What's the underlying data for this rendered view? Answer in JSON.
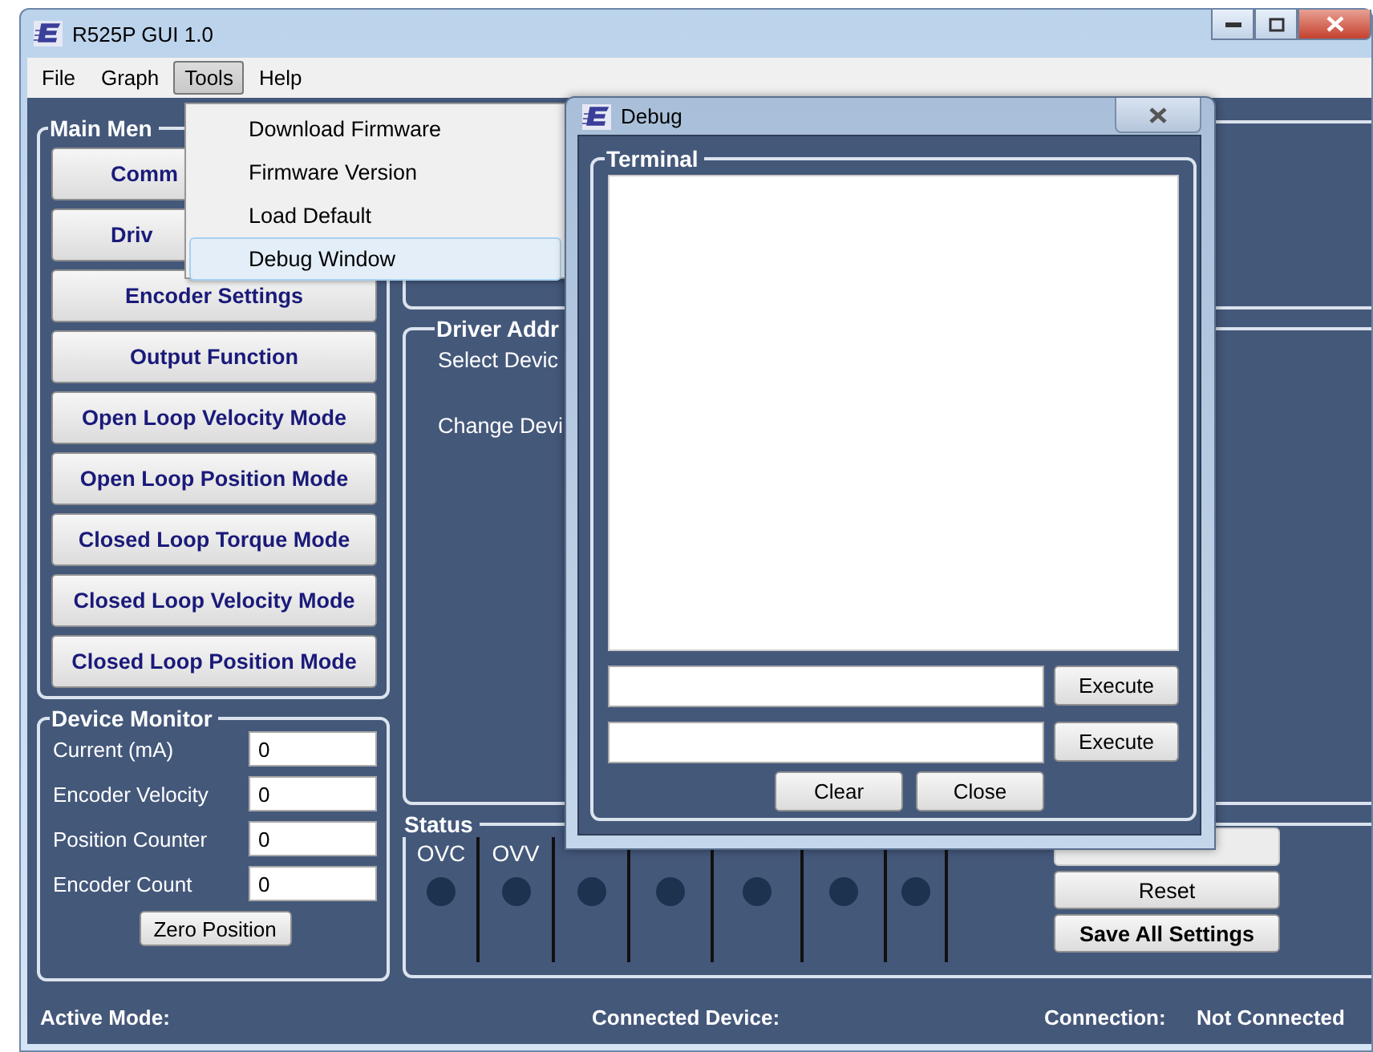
{
  "window": {
    "title": "R525P GUI 1.0"
  },
  "menu_bar": [
    {
      "label": "File",
      "selected": false
    },
    {
      "label": "Graph",
      "selected": false
    },
    {
      "label": "Tools",
      "selected": true
    },
    {
      "label": "Help",
      "selected": false
    }
  ],
  "tools_menu": [
    {
      "label": "Download Firmware",
      "selected": false
    },
    {
      "label": "Firmware Version",
      "selected": false
    },
    {
      "label": "Load Default",
      "selected": false
    },
    {
      "label": "Debug Window",
      "selected": true
    }
  ],
  "main_menu": {
    "title": "Main Men",
    "buttons": [
      {
        "kind": "covered",
        "label": "Comm"
      },
      {
        "kind": "covered",
        "label": "Driv"
      },
      {
        "kind": "normal",
        "label": "Encoder Settings"
      },
      {
        "kind": "normal",
        "label": "Output Function"
      },
      {
        "kind": "normal",
        "label": "Open Loop Velocity Mode"
      },
      {
        "kind": "normal",
        "label": "Open Loop Position Mode"
      },
      {
        "kind": "normal",
        "label": "Closed Loop Torque Mode"
      },
      {
        "kind": "normal",
        "label": "Closed Loop Velocity Mode"
      },
      {
        "kind": "normal",
        "label": "Closed Loop Position Mode"
      }
    ]
  },
  "device_monitor": {
    "title": "Device Monitor",
    "fields": [
      {
        "label": "Current (mA)",
        "value": "0"
      },
      {
        "label": "Encoder Velocity",
        "value": "0"
      },
      {
        "label": "Position Counter",
        "value": "0"
      },
      {
        "label": "Encoder Count",
        "value": "0"
      }
    ],
    "button": "Zero Position"
  },
  "driver_address": {
    "title": "Driver Addr",
    "labels": [
      "Select Devic",
      "Change Devi"
    ]
  },
  "status": {
    "title": "Status",
    "indicators": [
      {
        "kind": "labeled",
        "label": "OVC"
      },
      {
        "kind": "labeled",
        "label": "OVV"
      },
      {
        "kind": "covered"
      },
      {
        "kind": "covered"
      },
      {
        "kind": "covered"
      },
      {
        "kind": "covered"
      },
      {
        "kind": "covered"
      }
    ],
    "buttons": [
      {
        "kind": "covered",
        "disabled": true
      },
      {
        "kind": "normal",
        "label": "Reset",
        "disabled": false
      },
      {
        "kind": "bold",
        "label": "Save All Settings",
        "disabled": false
      }
    ]
  },
  "status_bar": {
    "active_mode_label": "Active Mode:",
    "connected_device_label": "Connected Device:",
    "connection_label": "Connection:",
    "connection_value": "Not Connected"
  },
  "debug_window": {
    "title": "Debug",
    "terminal_title": "Terminal",
    "command_rows": [
      {
        "button": "Execute"
      },
      {
        "button": "Execute"
      }
    ],
    "buttons": [
      "Clear",
      "Close"
    ]
  }
}
